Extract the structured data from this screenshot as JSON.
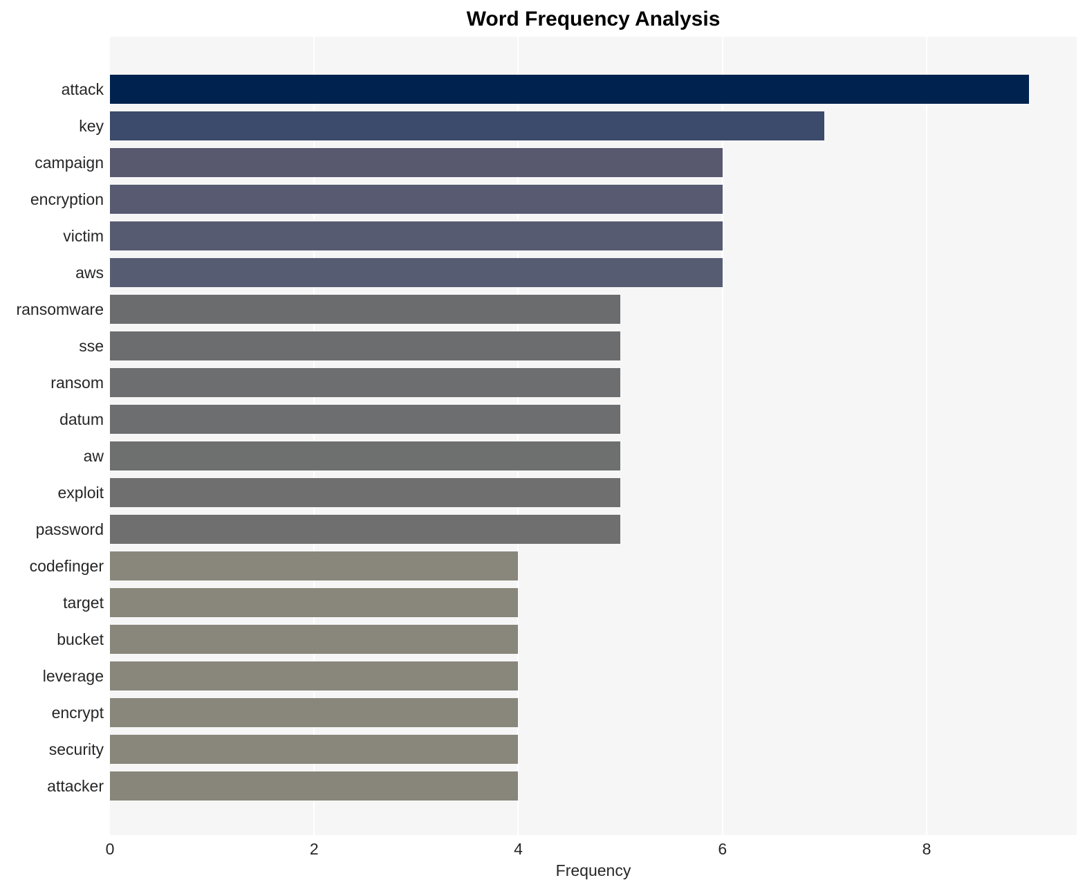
{
  "chart_data": {
    "type": "bar",
    "orientation": "horizontal",
    "title": "Word Frequency Analysis",
    "xlabel": "Frequency",
    "ylabel": "",
    "categories": [
      "attack",
      "key",
      "campaign",
      "encryption",
      "victim",
      "aws",
      "ransomware",
      "sse",
      "ransom",
      "datum",
      "aw",
      "exploit",
      "password",
      "codefinger",
      "target",
      "bucket",
      "leverage",
      "encrypt",
      "security",
      "attacker"
    ],
    "values": [
      9,
      7,
      6,
      6,
      6,
      6,
      5,
      5,
      5,
      5,
      5,
      5,
      5,
      4,
      4,
      4,
      4,
      4,
      4,
      4
    ],
    "bar_colors": [
      "#00224e",
      "#3c4a६b",
      "#58586f",
      "#575a70",
      "#575b71",
      "#565d73",
      "#6b6c6e",
      "#6c6d6f",
      "#6d6e6f",
      "#6d6e6f",
      "#6e6f6f",
      "#6f6f6f",
      "#6f6f6f",
      "#89867b",
      "#89867b",
      "#89867b",
      "#89867b",
      "#89867b",
      "#89867b",
      "#88857a"
    ],
    "xlim": [
      0,
      9.47
    ],
    "xticks": [
      0,
      2,
      4,
      6,
      8
    ],
    "xtick_labels": [
      "0",
      "2",
      "4",
      "6",
      "8"
    ],
    "grid": "vertical",
    "grid_color": "#ffffff",
    "plot_background": "#f6f6f7",
    "figure_background": "#ffffff",
    "legend": null
  }
}
